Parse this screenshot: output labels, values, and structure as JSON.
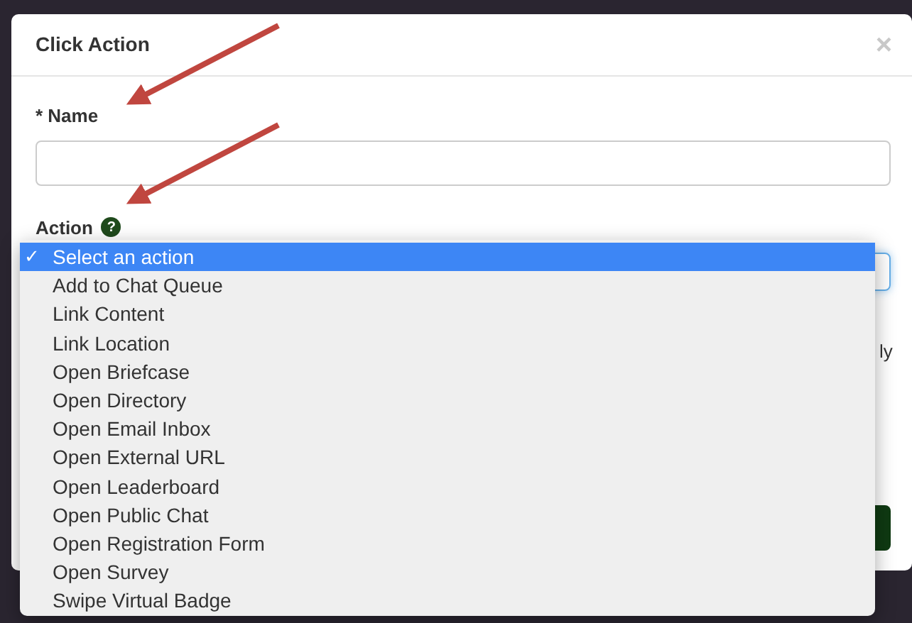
{
  "dialog": {
    "title": "Click Action",
    "close": "×"
  },
  "fields": [
    {
      "kind": "text",
      "label": "* Name"
    },
    {
      "kind": "select",
      "label": "Action",
      "help": "?"
    }
  ],
  "background_text": "ly",
  "dropdown": {
    "options": [
      {
        "label": "Select an action",
        "selected": true,
        "check": "✓"
      },
      {
        "label": "Add to Chat Queue",
        "selected": false
      },
      {
        "label": "Link Content",
        "selected": false
      },
      {
        "label": "Link Location",
        "selected": false
      },
      {
        "label": "Open Briefcase",
        "selected": false
      },
      {
        "label": "Open Directory",
        "selected": false
      },
      {
        "label": "Open Email Inbox",
        "selected": false
      },
      {
        "label": "Open External URL",
        "selected": false
      },
      {
        "label": "Open Leaderboard",
        "selected": false
      },
      {
        "label": "Open Public Chat",
        "selected": false
      },
      {
        "label": "Open Registration Form",
        "selected": false
      },
      {
        "label": "Open Survey",
        "selected": false
      },
      {
        "label": "Swipe Virtual Badge",
        "selected": false
      }
    ]
  }
}
